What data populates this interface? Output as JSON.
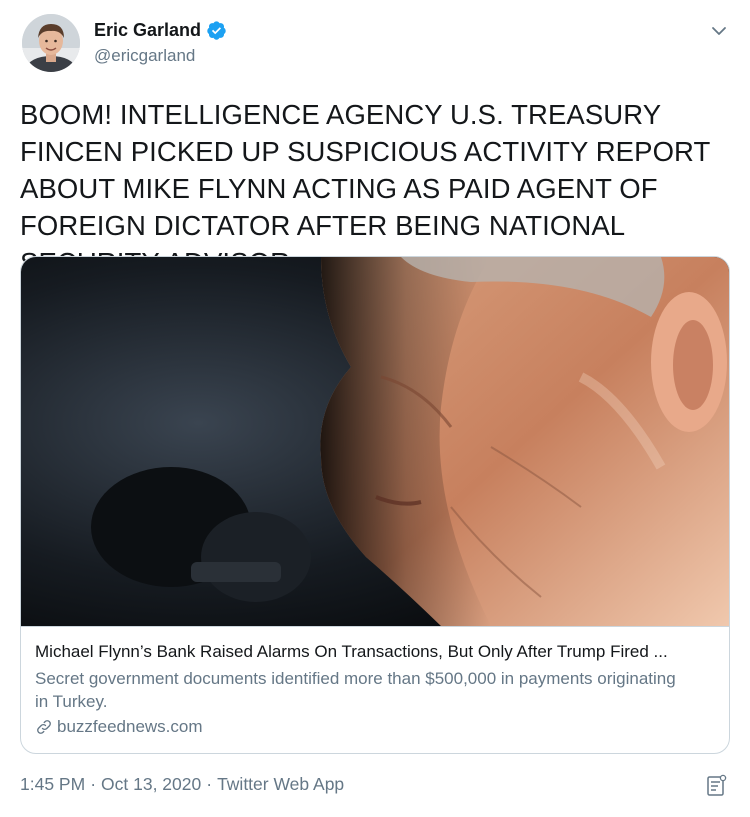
{
  "author": {
    "display_name": "Eric Garland",
    "handle": "@ericgarland",
    "verified": true
  },
  "tweet": {
    "text": "BOOM! INTELLIGENCE AGENCY U.S. TREASURY FINCEN PICKED UP SUSPICIOUS ACTIVITY REPORT ABOUT MIKE FLYNN ACTING AS PAID AGENT OF FOREIGN DICTATOR AFTER BEING NATIONAL SECURITY ADVISOR"
  },
  "card": {
    "title": "Michael Flynn’s Bank Raised Alarms On Transactions, But Only After Trump Fired ...",
    "description": "Secret government documents identified more than $500,000 in payments originating in Turkey.",
    "domain": "buzzfeednews.com",
    "image_alt": "Close-up photo of Michael Flynn"
  },
  "meta": {
    "time": "1:45 PM",
    "date": "Oct 13, 2020",
    "source": "Twitter Web App",
    "separator": "·"
  },
  "colors": {
    "verified_blue": "#1da1f2",
    "text": "#14171a",
    "muted": "#657786",
    "border": "#ccd6dd"
  },
  "icons": {
    "verified": "verified-badge-icon",
    "caret": "chevron-down-icon",
    "link": "link-icon",
    "analytics": "analytics-icon"
  }
}
